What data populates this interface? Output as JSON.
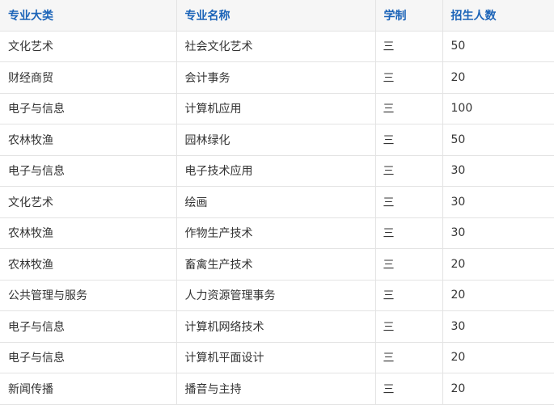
{
  "table": {
    "headers": [
      "专业大类",
      "专业名称",
      "学制",
      "招生人数"
    ],
    "rows": [
      [
        "文化艺术",
        "社会文化艺术",
        "三",
        "50"
      ],
      [
        "财经商贸",
        "会计事务",
        "三",
        "20"
      ],
      [
        "电子与信息",
        "计算机应用",
        "三",
        "100"
      ],
      [
        "农林牧渔",
        "园林绿化",
        "三",
        "50"
      ],
      [
        "电子与信息",
        "电子技术应用",
        "三",
        "30"
      ],
      [
        "文化艺术",
        "绘画",
        "三",
        "30"
      ],
      [
        "农林牧渔",
        "作物生产技术",
        "三",
        "30"
      ],
      [
        "农林牧渔",
        "畜禽生产技术",
        "三",
        "20"
      ],
      [
        "公共管理与服务",
        "人力资源管理事务",
        "三",
        "20"
      ],
      [
        "电子与信息",
        "计算机网络技术",
        "三",
        "30"
      ],
      [
        "电子与信息",
        "计算机平面设计",
        "三",
        "20"
      ],
      [
        "新闻传播",
        "播音与主持",
        "三",
        "20"
      ]
    ]
  },
  "colors": {
    "header_text": "#1c64b8",
    "header_bg": "#f6f6f6",
    "cell_text": "#333333",
    "border": "#e3e3e3"
  }
}
